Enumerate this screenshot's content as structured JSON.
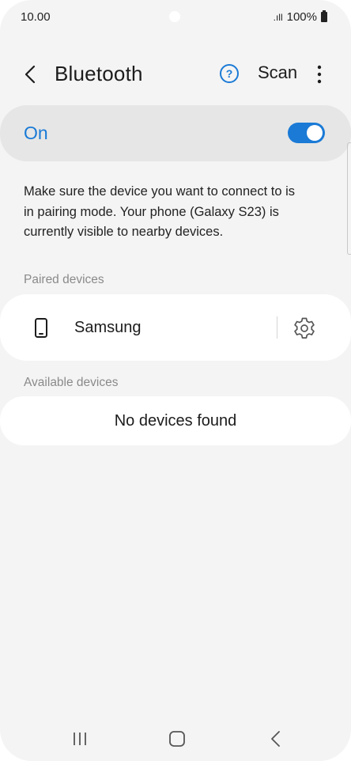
{
  "status_bar": {
    "time": "10.00",
    "signal": ".ıll",
    "battery": "100%"
  },
  "header": {
    "title": "Bluetooth",
    "back_icon": "chevron-left-icon",
    "help_icon": "help-circle-icon",
    "scan_label": "Scan",
    "more_icon": "more-vertical-icon"
  },
  "toggle": {
    "label": "On",
    "state": true,
    "accent_color": "#1a7ad6"
  },
  "info_text": "Make sure the device you want to connect to is in pairing mode. Your phone (Galaxy S23) is currently visible to nearby devices.",
  "paired": {
    "section_label": "Paired devices",
    "devices": [
      {
        "name": "Samsung",
        "icon": "smartphone-icon",
        "settings_icon": "gear-icon"
      }
    ]
  },
  "available": {
    "section_label": "Available devices",
    "empty_text": "No devices found"
  },
  "nav_bar": {
    "recents_icon": "recents-icon",
    "home_icon": "home-icon",
    "back_icon": "nav-back-icon"
  }
}
